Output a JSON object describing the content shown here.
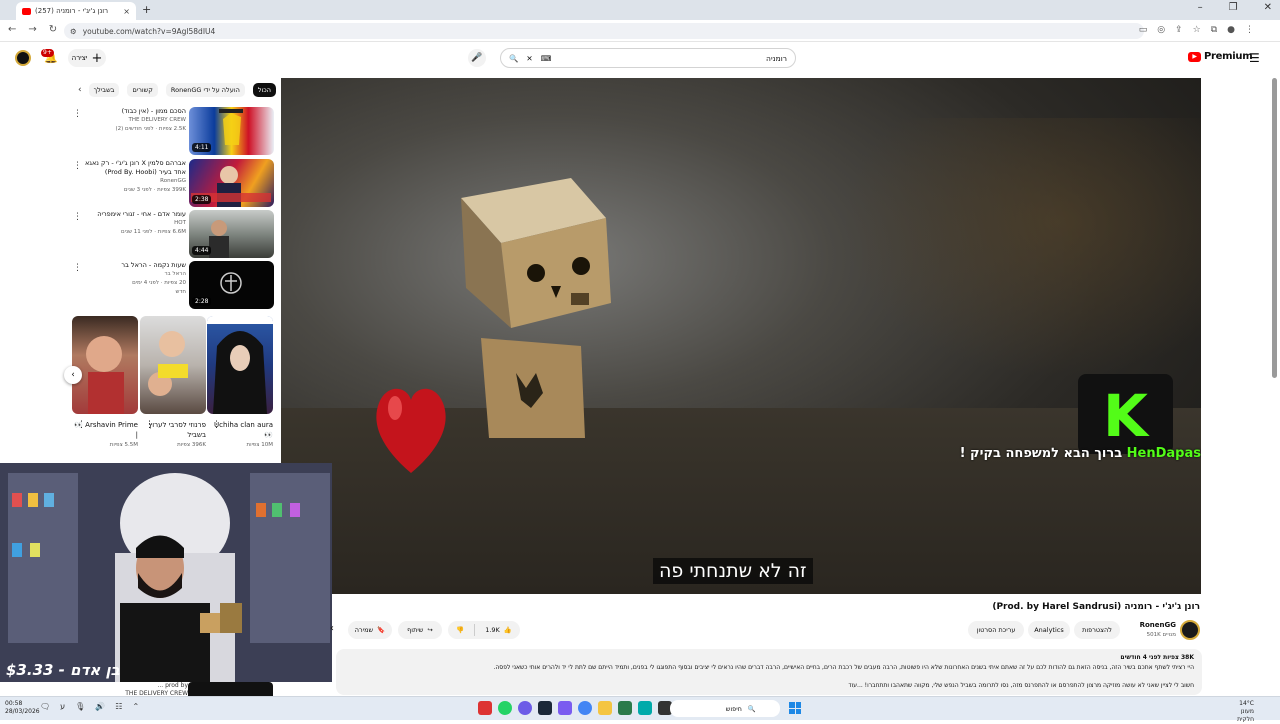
{
  "browser": {
    "tab_title": "רונן ג'יג'י - רומניה (257)",
    "url": "youtube.com/watch?v=9Agl58dIU4"
  },
  "header": {
    "notification_count": "9+",
    "create_label": "יצירה",
    "search_query": "רומניה",
    "premium_label": "Premium"
  },
  "chips": [
    "הכול",
    "הועלה על ידי RonenGG",
    "קשורים",
    "בשבילך"
  ],
  "related": [
    {
      "title": "הסכם ממון - (אין כבוד)",
      "channel": "THE DELIVERY CREW",
      "meta": "2.5K צפיות · לפני חודשים (2)",
      "duration": "4:11"
    },
    {
      "title": "אברהם סלמין X רונן ג'יג'י - רק נאגא אחד בעיר (Prod By. Hoobi)",
      "channel": "RonenGG",
      "meta": "399K צפיות · לפני 3 שנים",
      "duration": "2:38"
    },
    {
      "title": "עומר אדם - אחי - זגורי אימפריה",
      "channel": "HOT",
      "meta": "6.6M צפיות · לפני 11 שנים",
      "duration": "4:44"
    },
    {
      "title": "שעות נקמה - הראל בר",
      "channel": "הראל בר",
      "meta": "20 צפיות · לפני 4 ימים",
      "badge": "חדש",
      "duration": "2:28"
    }
  ],
  "shorts": [
    {
      "title": "Arshavin Prime 👀 |",
      "views": "5.5M צפיות"
    },
    {
      "title": "פרנוזי לסרבי לערוץ בשביל",
      "views": "396K צפיות"
    },
    {
      "title": "Uchiha clan aura 👀",
      "views": "10M צפיות"
    }
  ],
  "player": {
    "overlay_name": "HenDapas",
    "overlay_text": "ברוך הבא למשפחה בקיק !",
    "subtitle": "זה לא שתנחתי פה"
  },
  "webcam": {
    "donation": "$3.33 - בן אדם"
  },
  "video": {
    "title": "רונן ג'יג'י - רומניה (Prod. by Harel Sandrusi)",
    "channel": "RonenGG",
    "subscribers": "501K מנויים",
    "subscribe_label": "להצטרפות",
    "analytics_label": "Analytics",
    "edit_label": "עריכת הסרטון",
    "likes": "1.9K",
    "share_label": "שיתוף",
    "save_label": "שמירה",
    "desc_meta": "38K צפיות  לפני 4 חודשים",
    "desc_line1": "היי רציתי לשתף אתכם בשיר הזה, בניסה הזאת גם להודות לכם על זה שאתם איתי בשנים האחרונות שלא היו פשוטות, הרבה מעבים של רכבת הרים, בחיים האישיים, הרבה דברים שהיו נראים לי יציבים ובסוף התפוגגו לי בפנים, ותמיד הייתם שם לתת לי יד ולהרים אותי כשאני לפסה.",
    "desc_line2": "חשוב לי לציין שאני לא עושה מוזיקה מרצון להתפרסם או להתפרנס מזה, נסו לתרומה בשביל הנפש שלי, מקווה שתאהבו ותתחברו! ...עוד"
  },
  "partial_related": {
    "title": "prod by ...",
    "channel": "THE DELIVERY CREW"
  },
  "taskbar": {
    "time": "00:58",
    "date": "28/03/2026",
    "search_placeholder": "חיפוש",
    "temperature": "14°C",
    "weather": "מעונן חלקית"
  },
  "colors": {
    "youtube_red": "#ff0000",
    "kick_green": "#53fc18",
    "chip_active": "#0f0f0f"
  }
}
